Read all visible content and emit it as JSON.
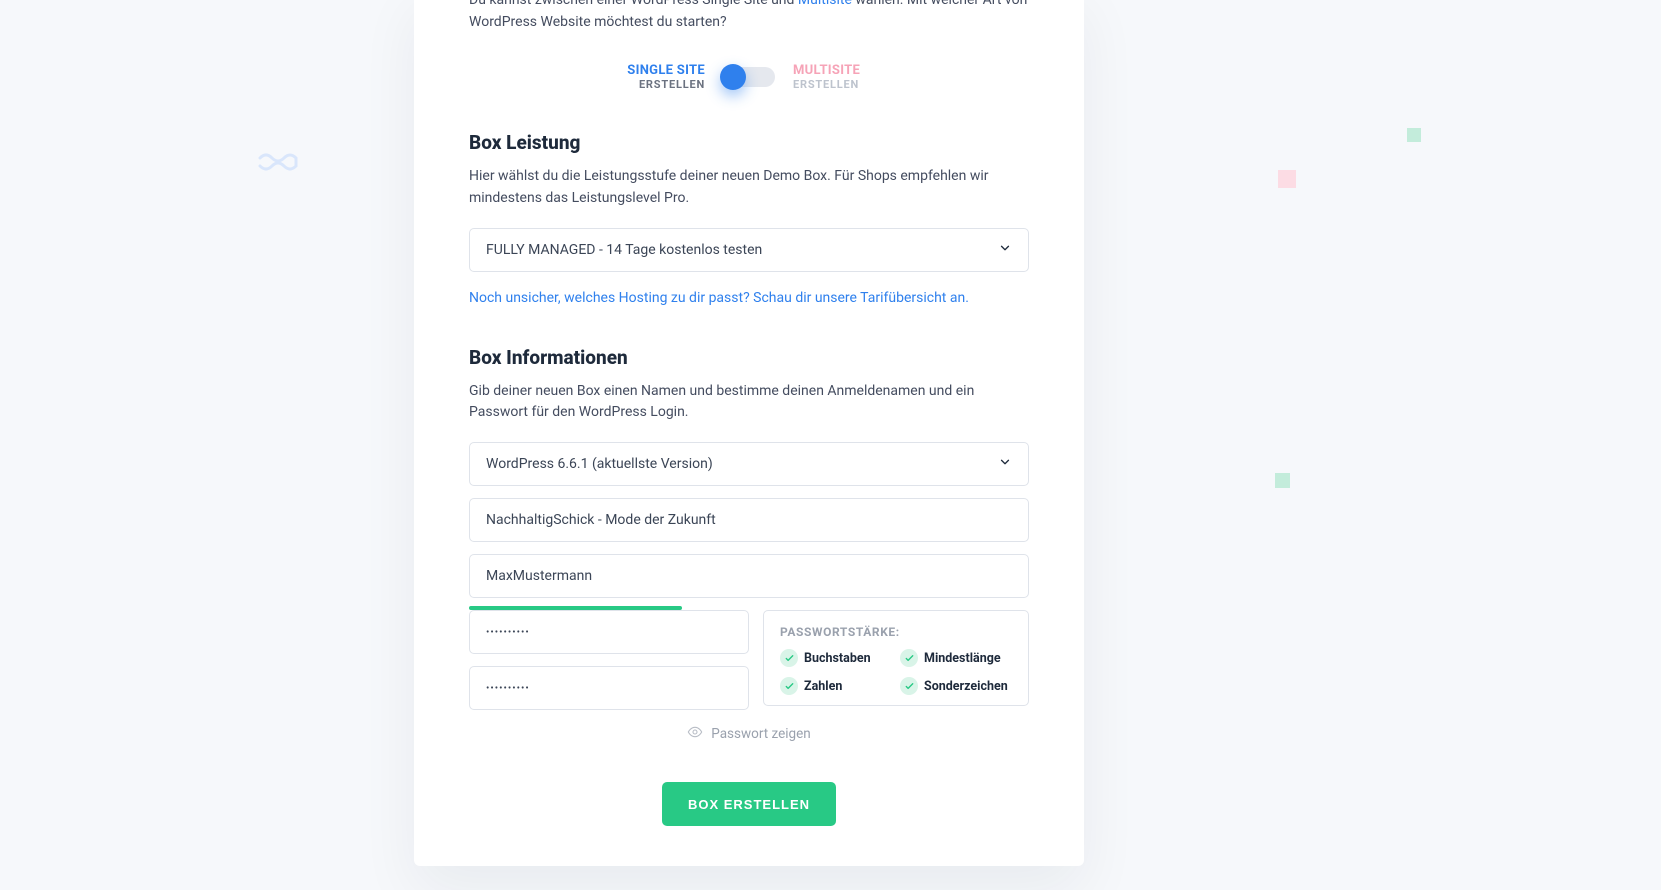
{
  "intro": {
    "prefix": "Du kannst zwischen einer WordPress Single Site und ",
    "link": "Multisite",
    "suffix": " wählen. Mit welcher Art von WordPress Website möchtest du starten?"
  },
  "toggle": {
    "left_title": "SINGLE SITE",
    "left_sub": "ERSTELLEN",
    "right_title": "MULTISITE",
    "right_sub": "ERSTELLEN"
  },
  "performance": {
    "title": "Box Leistung",
    "desc": "Hier wählst du die Leistungsstufe deiner neuen Demo Box. Für Shops empfehlen wir mindestens das Leistungslevel Pro.",
    "select_value": "FULLY MANAGED - 14 Tage kostenlos testen",
    "help_link": "Noch unsicher, welches Hosting zu dir passt? Schau dir unsere Tarifübersicht an."
  },
  "info": {
    "title": "Box Informationen",
    "desc": "Gib deiner neuen Box einen Namen und bestimme deinen Anmeldenamen und ein Passwort für den WordPress Login.",
    "version_value": "WordPress 6.6.1 (aktuellste Version)",
    "boxname_value": "NachhaltigSchick - Mode der Zukunft",
    "login_value": "MaxMustermann",
    "password_mask": "••••••••••",
    "password_confirm_mask": "••••••••••"
  },
  "pw_panel": {
    "title": "PASSWORTSTÄRKE:",
    "checks": {
      "letters": "Buchstaben",
      "minlen": "Mindestlänge",
      "numbers": "Zahlen",
      "special": "Sonderzeichen"
    }
  },
  "reveal_label": "Passwort zeigen",
  "create_label": "BOX ERSTELLEN"
}
